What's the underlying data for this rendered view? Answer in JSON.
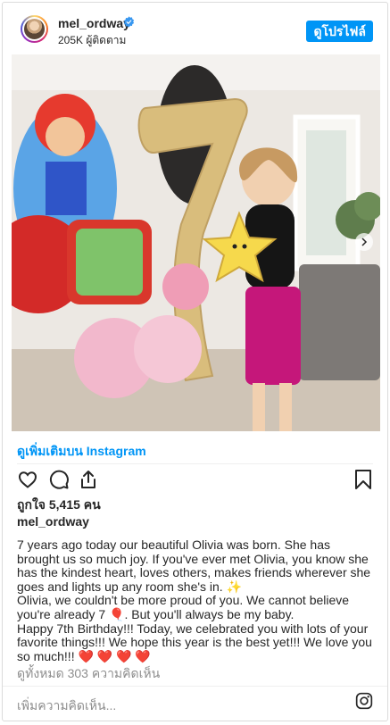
{
  "header": {
    "username": "mel_ordway",
    "followers": "205K ผู้ติดตาม",
    "profile_button": "ดูโปรไฟล์"
  },
  "post": {
    "view_more": "ดูเพิ่มเติมบน Instagram",
    "likes": "ถูกใจ 5,415 คน",
    "author": "mel_ordway",
    "caption": [
      "7 years ago today our beautiful Olivia was born. She has brought us so much joy. If you've ever met Olivia, you know she has the kindest heart, loves others, makes friends wherever she goes and lights up any room she's in. ✨",
      "Olivia, we couldn't be more proud of you. We cannot believe you're already 7 🎈. But you'll always be my baby.",
      "Happy 7th Birthday!!! Today, we celebrated you with lots of your favorite things!!! We hope this year is the best yet!!! We love you so much!!! ❤️ ❤️ ❤️ ❤️"
    ],
    "comments": "ดูทั้งหมด 303 ความคิดเห็น",
    "add_comment": "เพิ่มความคิดเห็น..."
  },
  "colors": {
    "accent": "#0095f6",
    "verified": "#3897f0",
    "muted": "#8e8e8e",
    "text": "#262626"
  },
  "icons": [
    "verified-icon",
    "next-arrow-icon",
    "heart-icon",
    "comment-icon",
    "share-icon",
    "bookmark-icon",
    "instagram-icon"
  ]
}
